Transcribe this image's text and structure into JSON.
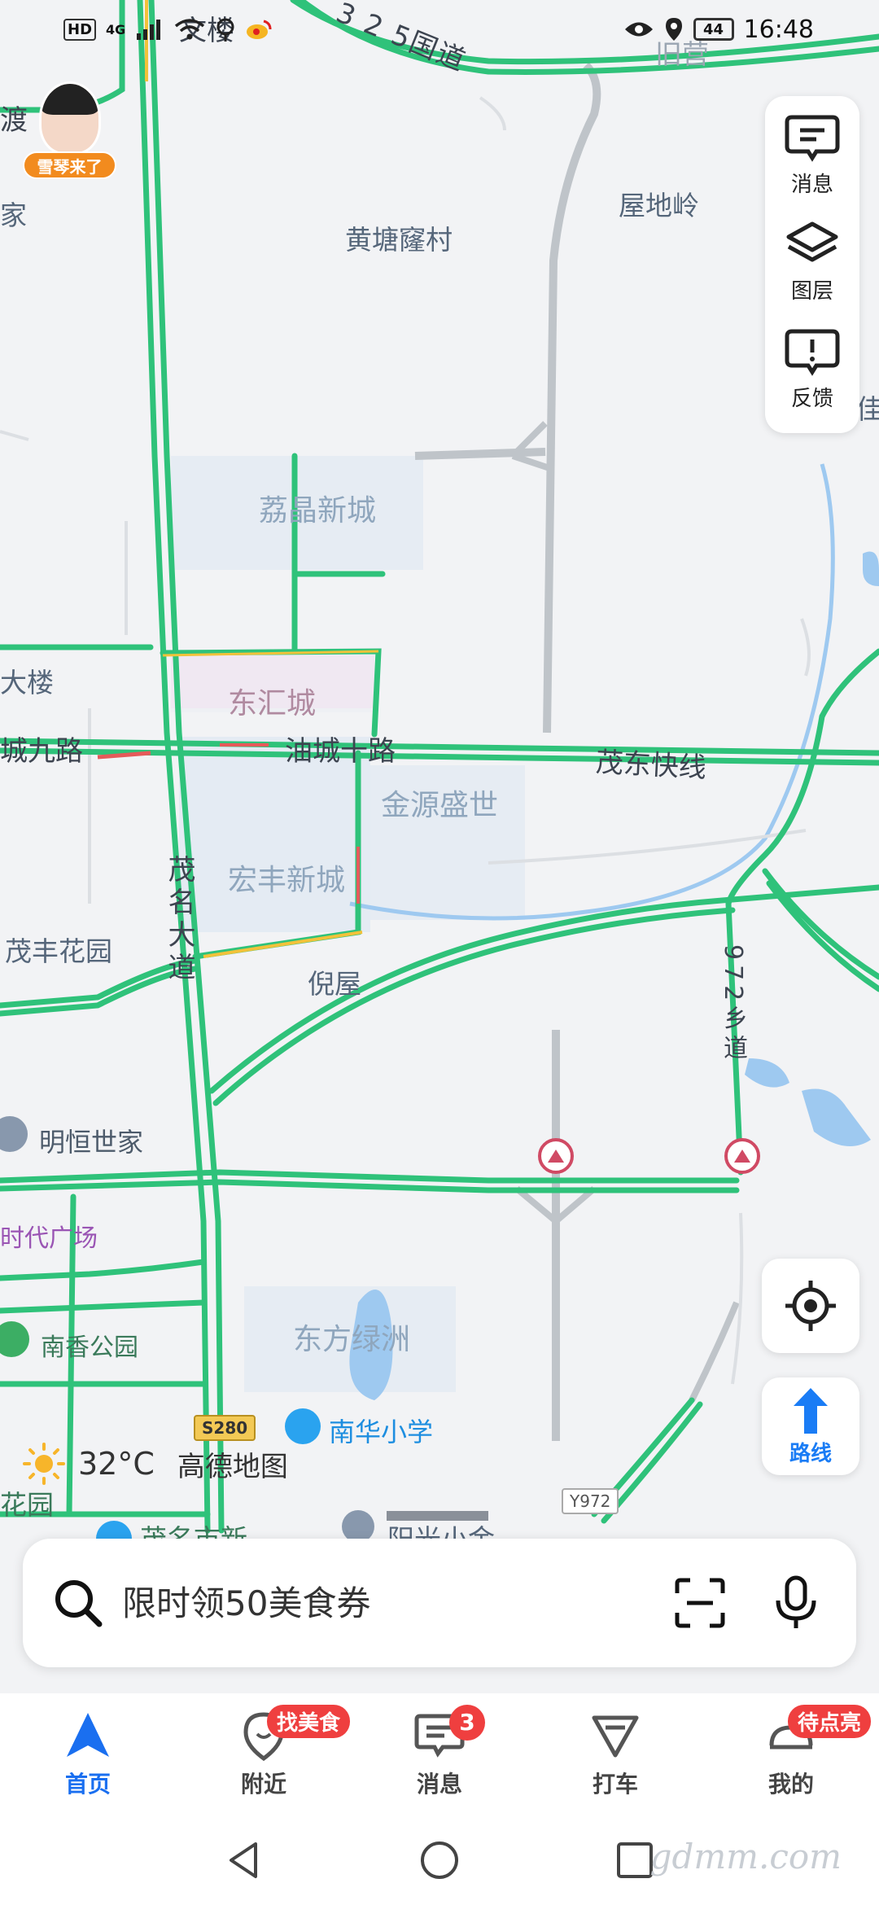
{
  "status_bar": {
    "time": "16:48",
    "battery": "44",
    "network": "4G",
    "hd": "HD"
  },
  "avatar": {
    "pill_text": "雪琴来了"
  },
  "tool_panel": {
    "items": [
      {
        "label": "消息",
        "icon": "message-icon"
      },
      {
        "label": "图层",
        "icon": "layers-icon"
      },
      {
        "label": "反馈",
        "icon": "feedback-icon"
      }
    ]
  },
  "map": {
    "labels": {
      "top_left_1": "渡",
      "top_left_2": "家",
      "road_325": "3 2 5国道",
      "wenqiao": "文楼",
      "jiuying": "旧营",
      "wudiling": "屋地岭",
      "huangtang": "黄塘窿村",
      "lijing": "荔晶新城",
      "dalou": "大楼",
      "donghui": "东汇城",
      "chengjiu": "城九路",
      "youcheng10": "油城十路",
      "maodong": "茂东快线",
      "jinyuan": "金源盛世",
      "hongfeng": "宏丰新城",
      "maoming_road": "茂名大道",
      "maofeng": "茂丰花园",
      "niwu": "倪屋",
      "road_972": "972乡道",
      "mingheng": "明恒世家",
      "shidai": "时代广场",
      "nanxiang": "南香公园",
      "dongfang": "东方绿洲",
      "nanhua": "南华小学",
      "huayuan": "花园",
      "maoming_city": "茂名市新",
      "yangguang": "阳光小金",
      "s280": "S280",
      "y972": "Y972",
      "right_edge": "佳"
    }
  },
  "weather": {
    "temp": "32°C",
    "brand": "高德地图"
  },
  "route_button": {
    "label": "路线"
  },
  "search": {
    "placeholder": "限时领50美食券"
  },
  "bottom_nav": {
    "items": [
      {
        "label": "首页",
        "icon": "home-arrow-icon",
        "active": true,
        "badge": ""
      },
      {
        "label": "附近",
        "icon": "nearby-pin-icon",
        "active": false,
        "badge": "找美食"
      },
      {
        "label": "消息",
        "icon": "message-icon",
        "active": false,
        "badge": "3"
      },
      {
        "label": "打车",
        "icon": "taxi-icon",
        "active": false,
        "badge": ""
      },
      {
        "label": "我的",
        "icon": "profile-icon",
        "active": false,
        "badge": "待点亮"
      }
    ]
  },
  "watermark": "gdmm.com",
  "colors": {
    "road_green": "#2fc27a",
    "accent_blue": "#1a6ff0",
    "badge_red": "#ef3f3f",
    "water_blue": "#9ec9f0"
  }
}
